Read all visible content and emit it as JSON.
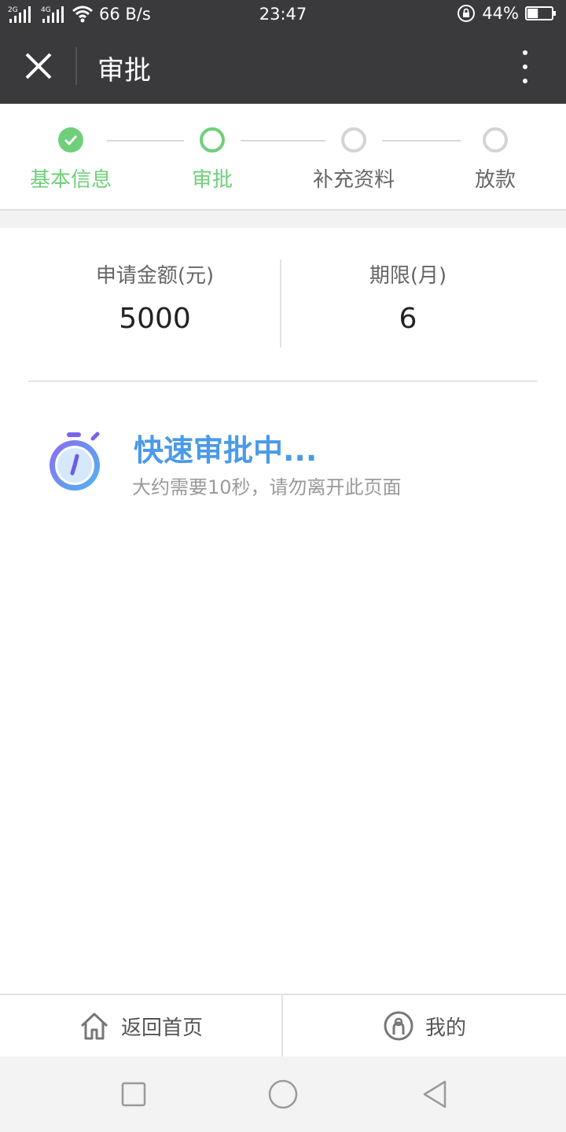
{
  "status_bar": {
    "signal_1": "2G",
    "signal_2": "4G",
    "net_speed": "66 B/s",
    "time": "23:47",
    "battery": "44%",
    "battery_level": 0.44
  },
  "header": {
    "title": "审批"
  },
  "steps": [
    {
      "label": "基本信息",
      "state": "done"
    },
    {
      "label": "审批",
      "state": "current"
    },
    {
      "label": "补充资料",
      "state": "pending"
    },
    {
      "label": "放款",
      "state": "pending"
    }
  ],
  "colors": {
    "accent_green": "#6fcf7a",
    "accent_blue": "#4a9ae8",
    "dark_bar": "#3a3a3c",
    "pending_gray": "#d4d4d4"
  },
  "loan": {
    "amount_label": "申请金额(元)",
    "amount_value": "5000",
    "term_label": "期限(月)",
    "term_value": "6"
  },
  "approval": {
    "title": "快速审批中...",
    "subtitle": "大约需要10秒，请勿离开此页面"
  },
  "bottom_nav": {
    "home_label": "返回首页",
    "mine_label": "我的"
  }
}
